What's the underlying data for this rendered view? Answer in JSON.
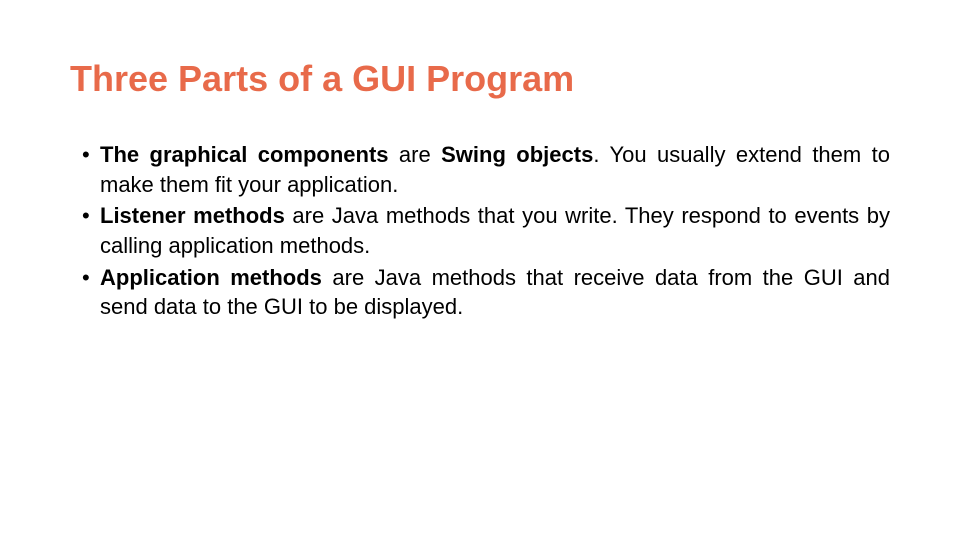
{
  "title": "Three Parts of a GUI Program",
  "bullets": [
    {
      "bold1": "The graphical components",
      "mid1": " are ",
      "bold2": "Swing objects",
      "rest": ". You usually extend them to make them fit your application."
    },
    {
      "bold1": "Listener methods",
      "mid1": " are Java methods that you write. They respond to events by calling application methods.",
      "bold2": "",
      "rest": ""
    },
    {
      "bold1": "Application methods",
      "mid1": " are Java methods that receive data from the GUI and send data to the GUI to be displayed.",
      "bold2": "",
      "rest": ""
    }
  ]
}
